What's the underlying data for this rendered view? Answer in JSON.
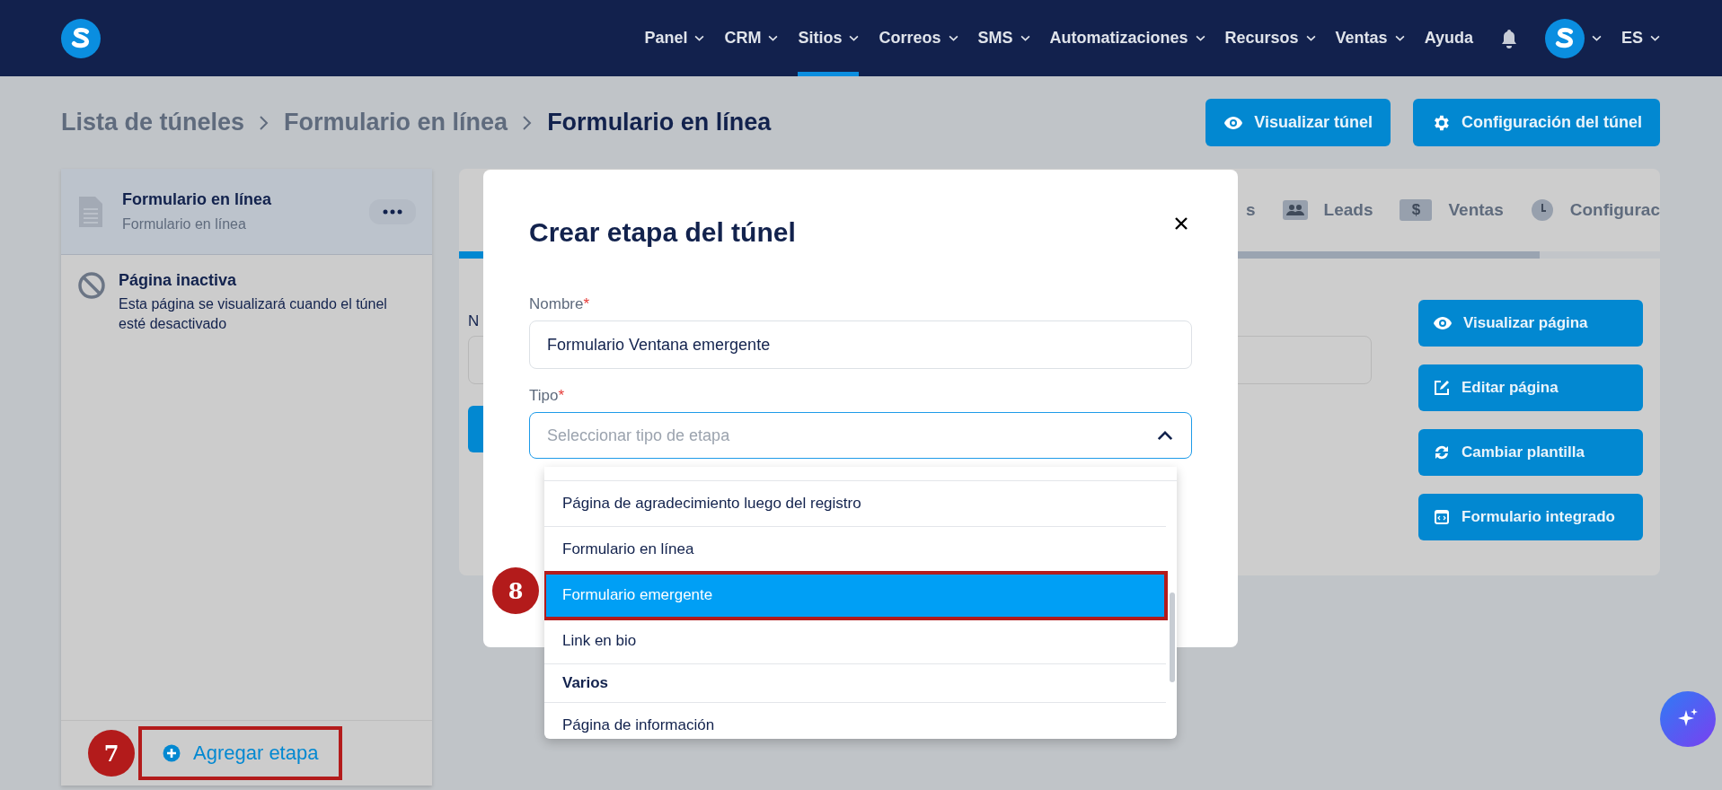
{
  "nav": {
    "items": [
      {
        "label": "Panel",
        "dropdown": true,
        "selected": false
      },
      {
        "label": "CRM",
        "dropdown": true,
        "selected": false
      },
      {
        "label": "Sitios",
        "dropdown": true,
        "selected": true
      },
      {
        "label": "Correos",
        "dropdown": true,
        "selected": false
      },
      {
        "label": "SMS",
        "dropdown": true,
        "selected": false
      },
      {
        "label": "Automatizaciones",
        "dropdown": true,
        "selected": false
      },
      {
        "label": "Recursos",
        "dropdown": true,
        "selected": false
      },
      {
        "label": "Ventas",
        "dropdown": true,
        "selected": false
      },
      {
        "label": "Ayuda",
        "dropdown": false,
        "selected": false
      }
    ],
    "language": "ES"
  },
  "breadcrumb": [
    "Lista de túneles",
    "Formulario en línea",
    "Formulario en línea"
  ],
  "header_buttons": [
    "Visualizar túnel",
    "Configuración del túnel"
  ],
  "left_panel": {
    "stage": {
      "title": "Formulario en línea",
      "subtitle": "Formulario en línea"
    },
    "inactive_page": {
      "title": "Página inactiva",
      "text": "Esta página se visualizará cuando el túnel esté desactivado"
    },
    "add_button": "Agregar etapa"
  },
  "card": {
    "tabs": [
      {
        "label": "s"
      },
      {
        "label": "Leads"
      },
      {
        "label": "Ventas",
        "icon_text": "$"
      },
      {
        "label": "Configurac"
      }
    ],
    "field_label": "N",
    "action_buttons": [
      "Visualizar página",
      "Editar página",
      "Cambiar plantilla",
      "Formulario integrado"
    ]
  },
  "modal": {
    "title": "Crear etapa del túnel",
    "fields": [
      {
        "label": "Nombre",
        "required_mark": "*",
        "value": "Formulario Ventana emergente"
      },
      {
        "label": "Tipo",
        "required_mark": "*",
        "placeholder": "Seleccionar tipo de etapa",
        "expanded": true
      }
    ],
    "options": [
      {
        "kind": "option",
        "label": "Página de agradecimiento luego del registro",
        "selected": false
      },
      {
        "kind": "option",
        "label": "Formulario en línea",
        "selected": false
      },
      {
        "kind": "option",
        "label": "Formulario emergente",
        "selected": true
      },
      {
        "kind": "option",
        "label": "Link en bio",
        "selected": false
      },
      {
        "kind": "group",
        "label": "Varios"
      },
      {
        "kind": "option",
        "label": "Página de información",
        "selected": false
      }
    ]
  },
  "annotations": [
    {
      "number": "8"
    },
    {
      "number": "7"
    }
  ]
}
